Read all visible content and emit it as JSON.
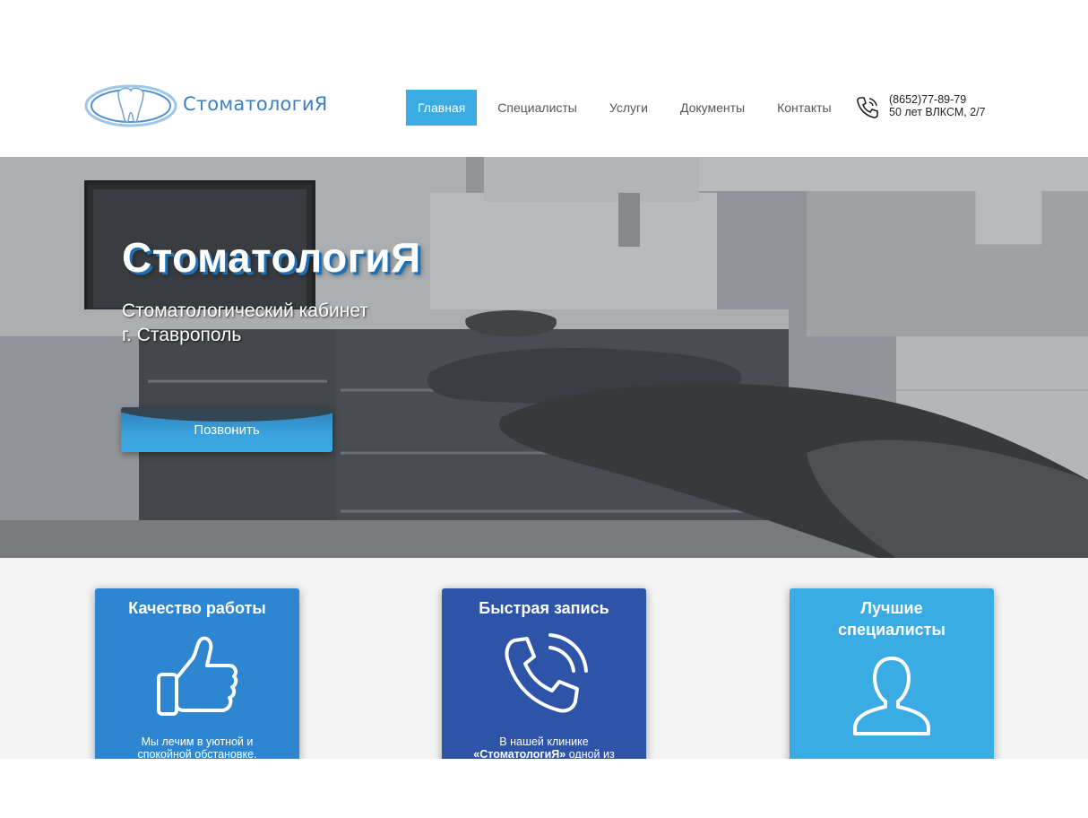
{
  "header": {
    "logo_text": "СтоматологиЯ",
    "nav": [
      {
        "label": "Главная",
        "active": true
      },
      {
        "label": "Специалисты",
        "active": false
      },
      {
        "label": "Услуги",
        "active": false
      },
      {
        "label": "Документы",
        "active": false
      },
      {
        "label": "Контакты",
        "active": false
      }
    ],
    "phone": "(8652)77-89-79",
    "address": "50 лет ВЛКСМ, 2/7",
    "phone_icon": "phone-icon"
  },
  "hero": {
    "title": "СтоматологиЯ",
    "subtitle_line1": "Стоматологический кабинет",
    "subtitle_line2": "г. Ставрополь",
    "button": "Позвонить"
  },
  "features": [
    {
      "title": "Качество работы",
      "icon": "thumbs-up-icon",
      "text_line1": "Мы лечим в уютной и",
      "text_line2": "спокойной обстановке.",
      "color": "#2f86d0"
    },
    {
      "title": "Быстрая запись",
      "icon": "phone-icon",
      "text_line1": "В нашей клинике",
      "text_line2_bold": "«СтоматологиЯ»",
      "text_line2_rest": " одной из",
      "color": "#2d54a6"
    },
    {
      "title": "Лучшие специалисты",
      "icon": "user-icon",
      "text_line1": "",
      "text_line2": "",
      "color": "#3aabe3"
    }
  ],
  "colors": {
    "accent": "#3aabe3",
    "brand_blue": "#3b7fc4"
  }
}
